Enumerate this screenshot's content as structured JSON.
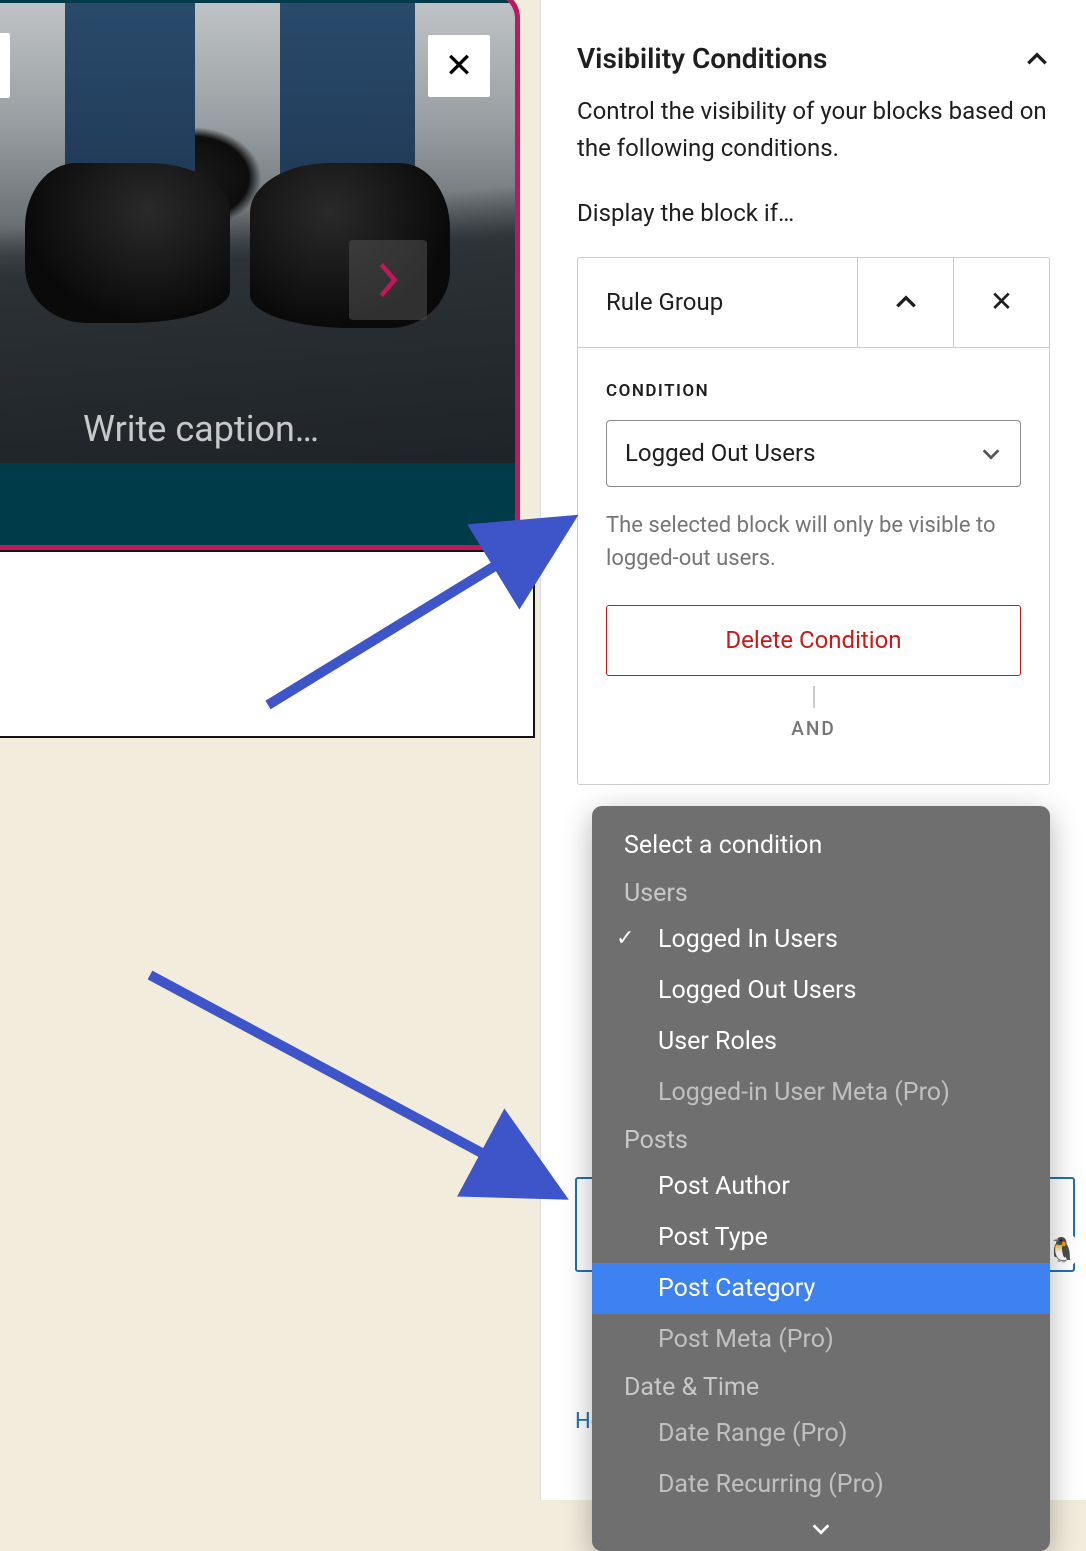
{
  "editor": {
    "caption_placeholder": "Write caption…"
  },
  "sidebar": {
    "panel_title": "Visibility Conditions",
    "description": "Control the visibility of your blocks based on the following conditions.",
    "display_if": "Display the block if…",
    "rule_group_label": "Rule Group",
    "condition_label": "CONDITION",
    "condition_value": "Logged Out Users",
    "condition_help": "The selected block will only be visible to logged-out users.",
    "delete_label": "Delete Condition",
    "and_label": "AND",
    "help_link_prefix": "He"
  },
  "dropdown": {
    "placeholder": "Select a condition",
    "groups": [
      {
        "label": "Users",
        "items": [
          {
            "label": "Logged In Users",
            "checked": true
          },
          {
            "label": "Logged Out Users"
          },
          {
            "label": "User Roles"
          },
          {
            "label": "Logged-in User Meta (Pro)",
            "disabled": true
          }
        ]
      },
      {
        "label": "Posts",
        "items": [
          {
            "label": "Post Author"
          },
          {
            "label": "Post Type"
          },
          {
            "label": "Post Category",
            "highlight": true
          },
          {
            "label": "Post Meta (Pro)",
            "disabled": true
          }
        ]
      },
      {
        "label": "Date & Time",
        "items": [
          {
            "label": "Date Range (Pro)",
            "disabled": true
          },
          {
            "label": "Date Recurring (Pro)",
            "disabled": true
          }
        ]
      }
    ]
  }
}
